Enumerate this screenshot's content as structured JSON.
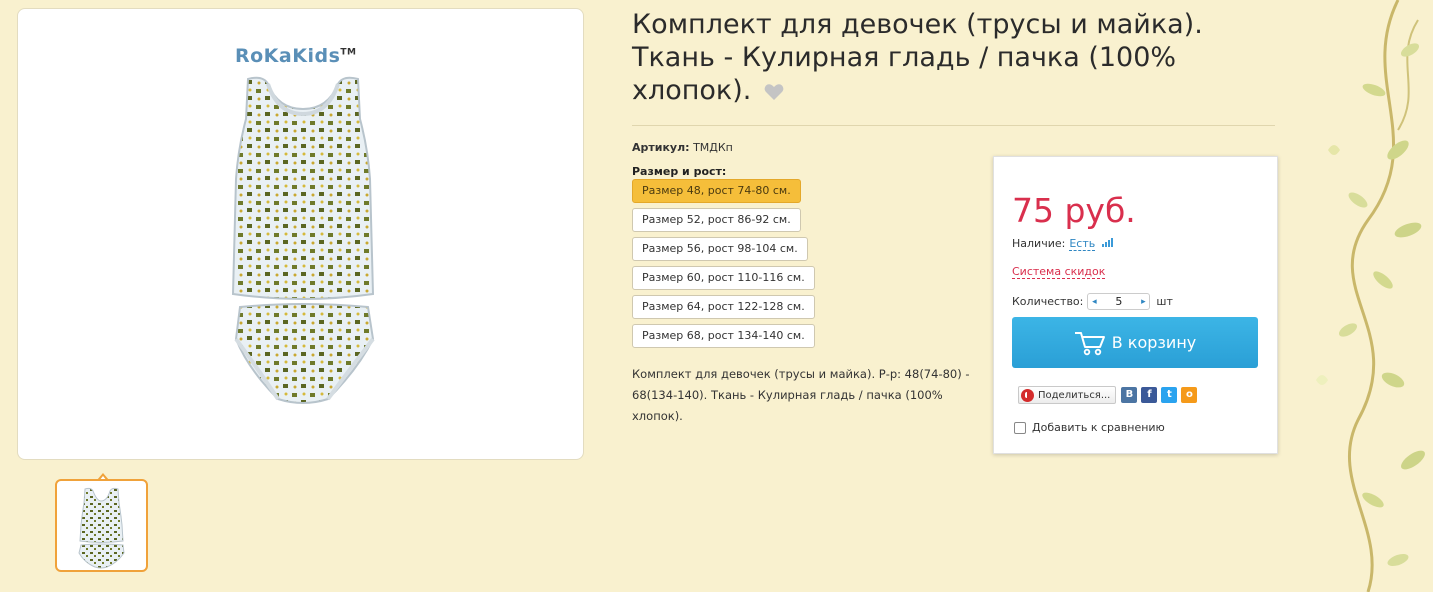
{
  "product": {
    "title": "Комплект для девочек (трусы и майка). Ткань - Кулирная гладь / пачка (100% хлопок).",
    "brand": "RoKaKids",
    "brand_tm": "TM",
    "sku_label": "Артикул:",
    "sku_value": "ТМДКп",
    "size_label": "Размер и рост:",
    "sizes": [
      "Размер 48, рост 74-80 см.",
      "Размер 52, рост 86-92 см.",
      "Размер 56, рост 98-104 см.",
      "Размер 60, рост 110-116 см.",
      "Размер 64, рост 122-128 см.",
      "Размер 68, рост 134-140 см."
    ],
    "selected_size_index": 0,
    "description": "Комплект для девочек (трусы и майка). Р-р: 48(74-80) - 68(134-140). Ткань - Кулирная гладь / пачка (100% хлопок)."
  },
  "buy_box": {
    "price": "75 руб.",
    "availability_label": "Наличие:",
    "availability_value": "Есть",
    "discount_link": "Система скидок",
    "quantity_label": "Количество:",
    "quantity_value": "5",
    "quantity_unit": "шт",
    "cart_button": "В корзину",
    "share_button": "Поделиться...",
    "compare_label": "Добавить к сравнению"
  },
  "colors": {
    "price": "#d92f4d",
    "accent": "#2e86c2",
    "selected_size": "#f5be3a",
    "cart_button": "#2a9fd6",
    "page_background": "#f9f1cf"
  },
  "icons": [
    "heart-icon",
    "signal-icon",
    "cart-icon",
    "share-icon",
    "vk-icon",
    "facebook-icon",
    "twitter-icon",
    "odnoklassniki-icon",
    "checkbox-icon"
  ]
}
